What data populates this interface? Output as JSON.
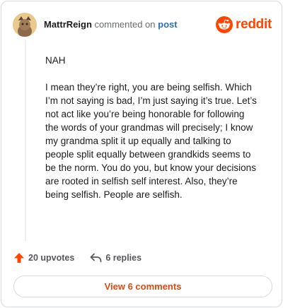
{
  "header": {
    "username": "MattrReign",
    "action_text": "commented on",
    "post_link": "post",
    "brand": "reddit"
  },
  "comment": {
    "paragraphs": [
      "NAH",
      "I mean they’re right, you are being selfish. Which I’m not saying is bad, I’m just saying it’s true. Let’s not act like you’re being honorable for following the words of your grandmas will precisely; I know my grandma split it up equally and talking to people split equally between grandkids seems to be the norm. You do you, but know your decisions are rooted in selfish self interest. Also, they’re being selfish. People are selfish."
    ]
  },
  "actions": {
    "upvotes": "20 upvotes",
    "replies": "6 replies"
  },
  "footer": {
    "view_comments": "View 6 comments"
  },
  "colors": {
    "brand": "#ff4500",
    "link": "#2a6fb0",
    "cta": "#e0470f"
  }
}
